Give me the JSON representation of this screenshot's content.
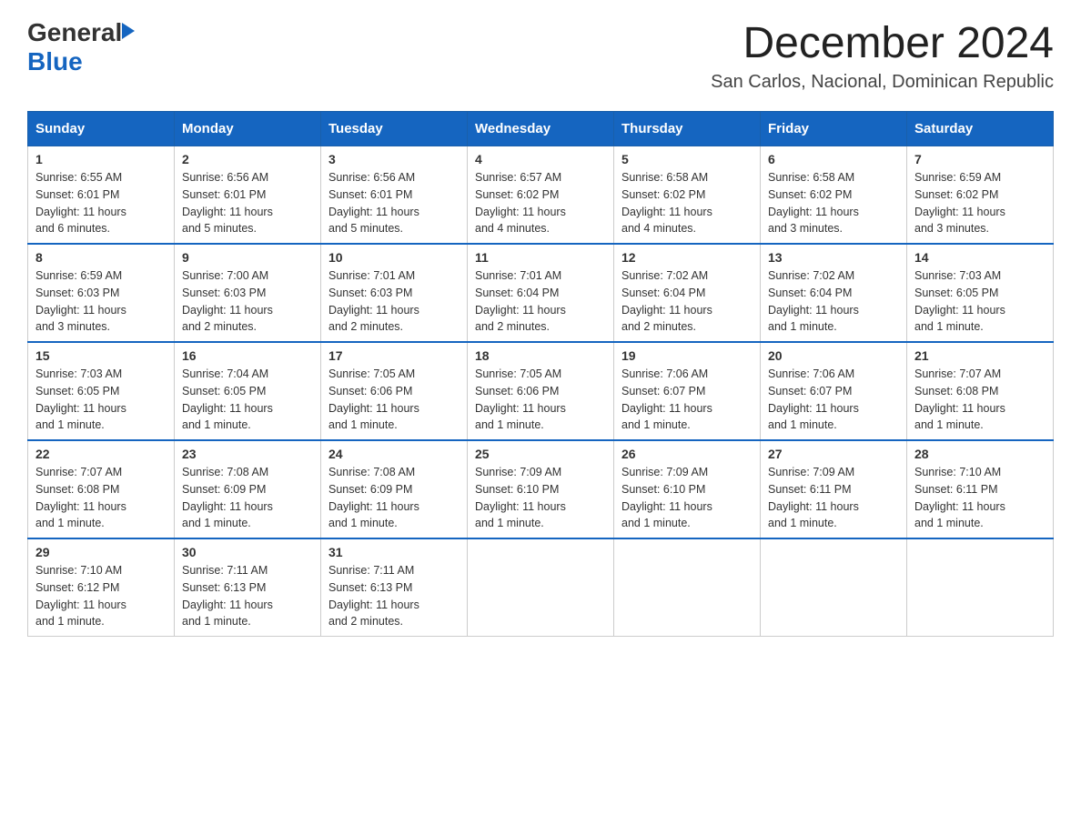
{
  "header": {
    "logo_general": "General",
    "logo_blue": "Blue",
    "month_title": "December 2024",
    "location": "San Carlos, Nacional, Dominican Republic"
  },
  "days_of_week": [
    "Sunday",
    "Monday",
    "Tuesday",
    "Wednesday",
    "Thursday",
    "Friday",
    "Saturday"
  ],
  "weeks": [
    [
      {
        "day": "1",
        "info": "Sunrise: 6:55 AM\nSunset: 6:01 PM\nDaylight: 11 hours\nand 6 minutes."
      },
      {
        "day": "2",
        "info": "Sunrise: 6:56 AM\nSunset: 6:01 PM\nDaylight: 11 hours\nand 5 minutes."
      },
      {
        "day": "3",
        "info": "Sunrise: 6:56 AM\nSunset: 6:01 PM\nDaylight: 11 hours\nand 5 minutes."
      },
      {
        "day": "4",
        "info": "Sunrise: 6:57 AM\nSunset: 6:02 PM\nDaylight: 11 hours\nand 4 minutes."
      },
      {
        "day": "5",
        "info": "Sunrise: 6:58 AM\nSunset: 6:02 PM\nDaylight: 11 hours\nand 4 minutes."
      },
      {
        "day": "6",
        "info": "Sunrise: 6:58 AM\nSunset: 6:02 PM\nDaylight: 11 hours\nand 3 minutes."
      },
      {
        "day": "7",
        "info": "Sunrise: 6:59 AM\nSunset: 6:02 PM\nDaylight: 11 hours\nand 3 minutes."
      }
    ],
    [
      {
        "day": "8",
        "info": "Sunrise: 6:59 AM\nSunset: 6:03 PM\nDaylight: 11 hours\nand 3 minutes."
      },
      {
        "day": "9",
        "info": "Sunrise: 7:00 AM\nSunset: 6:03 PM\nDaylight: 11 hours\nand 2 minutes."
      },
      {
        "day": "10",
        "info": "Sunrise: 7:01 AM\nSunset: 6:03 PM\nDaylight: 11 hours\nand 2 minutes."
      },
      {
        "day": "11",
        "info": "Sunrise: 7:01 AM\nSunset: 6:04 PM\nDaylight: 11 hours\nand 2 minutes."
      },
      {
        "day": "12",
        "info": "Sunrise: 7:02 AM\nSunset: 6:04 PM\nDaylight: 11 hours\nand 2 minutes."
      },
      {
        "day": "13",
        "info": "Sunrise: 7:02 AM\nSunset: 6:04 PM\nDaylight: 11 hours\nand 1 minute."
      },
      {
        "day": "14",
        "info": "Sunrise: 7:03 AM\nSunset: 6:05 PM\nDaylight: 11 hours\nand 1 minute."
      }
    ],
    [
      {
        "day": "15",
        "info": "Sunrise: 7:03 AM\nSunset: 6:05 PM\nDaylight: 11 hours\nand 1 minute."
      },
      {
        "day": "16",
        "info": "Sunrise: 7:04 AM\nSunset: 6:05 PM\nDaylight: 11 hours\nand 1 minute."
      },
      {
        "day": "17",
        "info": "Sunrise: 7:05 AM\nSunset: 6:06 PM\nDaylight: 11 hours\nand 1 minute."
      },
      {
        "day": "18",
        "info": "Sunrise: 7:05 AM\nSunset: 6:06 PM\nDaylight: 11 hours\nand 1 minute."
      },
      {
        "day": "19",
        "info": "Sunrise: 7:06 AM\nSunset: 6:07 PM\nDaylight: 11 hours\nand 1 minute."
      },
      {
        "day": "20",
        "info": "Sunrise: 7:06 AM\nSunset: 6:07 PM\nDaylight: 11 hours\nand 1 minute."
      },
      {
        "day": "21",
        "info": "Sunrise: 7:07 AM\nSunset: 6:08 PM\nDaylight: 11 hours\nand 1 minute."
      }
    ],
    [
      {
        "day": "22",
        "info": "Sunrise: 7:07 AM\nSunset: 6:08 PM\nDaylight: 11 hours\nand 1 minute."
      },
      {
        "day": "23",
        "info": "Sunrise: 7:08 AM\nSunset: 6:09 PM\nDaylight: 11 hours\nand 1 minute."
      },
      {
        "day": "24",
        "info": "Sunrise: 7:08 AM\nSunset: 6:09 PM\nDaylight: 11 hours\nand 1 minute."
      },
      {
        "day": "25",
        "info": "Sunrise: 7:09 AM\nSunset: 6:10 PM\nDaylight: 11 hours\nand 1 minute."
      },
      {
        "day": "26",
        "info": "Sunrise: 7:09 AM\nSunset: 6:10 PM\nDaylight: 11 hours\nand 1 minute."
      },
      {
        "day": "27",
        "info": "Sunrise: 7:09 AM\nSunset: 6:11 PM\nDaylight: 11 hours\nand 1 minute."
      },
      {
        "day": "28",
        "info": "Sunrise: 7:10 AM\nSunset: 6:11 PM\nDaylight: 11 hours\nand 1 minute."
      }
    ],
    [
      {
        "day": "29",
        "info": "Sunrise: 7:10 AM\nSunset: 6:12 PM\nDaylight: 11 hours\nand 1 minute."
      },
      {
        "day": "30",
        "info": "Sunrise: 7:11 AM\nSunset: 6:13 PM\nDaylight: 11 hours\nand 1 minute."
      },
      {
        "day": "31",
        "info": "Sunrise: 7:11 AM\nSunset: 6:13 PM\nDaylight: 11 hours\nand 2 minutes."
      },
      {
        "day": "",
        "info": ""
      },
      {
        "day": "",
        "info": ""
      },
      {
        "day": "",
        "info": ""
      },
      {
        "day": "",
        "info": ""
      }
    ]
  ]
}
